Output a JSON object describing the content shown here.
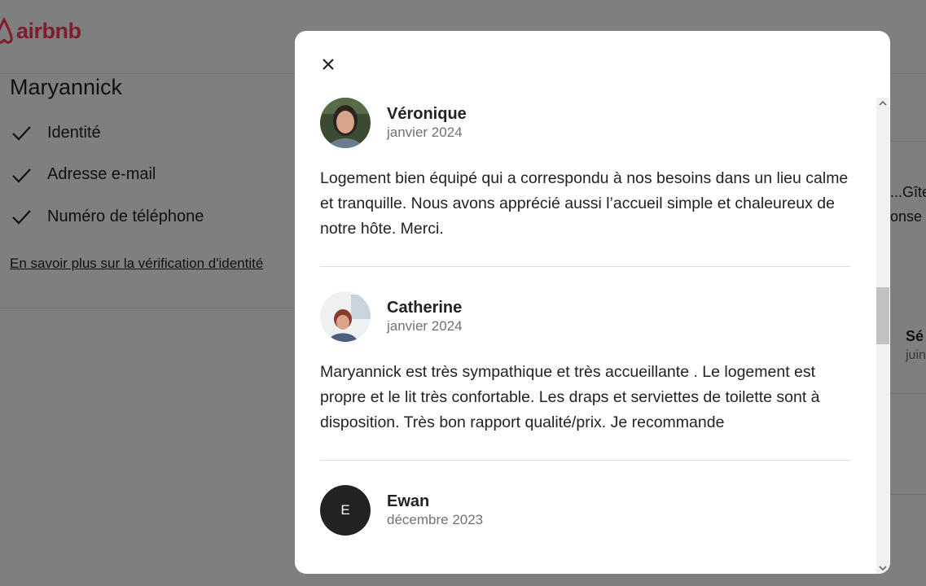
{
  "brand": {
    "name": "airbnb",
    "color": "#FF385C"
  },
  "host": {
    "name": "Maryannick",
    "verifications": [
      "Identité",
      "Adresse e-mail",
      "Numéro de téléphone"
    ],
    "verification_link": "En savoir plus sur la vérification d'identité"
  },
  "background_right": {
    "fragment_1": "...Gîte",
    "fragment_2": "onse",
    "fragment_3": "Sé",
    "fragment_4": "juin"
  },
  "modal": {
    "close_icon": "close-icon",
    "reviews": [
      {
        "name": "Véronique",
        "date": "janvier 2024",
        "avatar": "photo",
        "text": "Logement bien équipé qui a correspondu à nos besoins dans un lieu calme et tranquille. Nous avons apprécié aussi l’accueil simple et chaleureux de notre hôte. Merci."
      },
      {
        "name": "Catherine",
        "date": "janvier 2024",
        "avatar": "photo",
        "text": "Maryannick est très sympathique et très accueillante . Le logement est propre et le lit très confortable. Les draps et serviettes de toilette sont à disposition. Très bon rapport qualité/prix. Je recommande"
      },
      {
        "name": "Ewan",
        "date": "décembre 2023",
        "avatar": "letter",
        "avatar_letter": "E",
        "text": ""
      }
    ],
    "scroll_position": 0.45
  }
}
